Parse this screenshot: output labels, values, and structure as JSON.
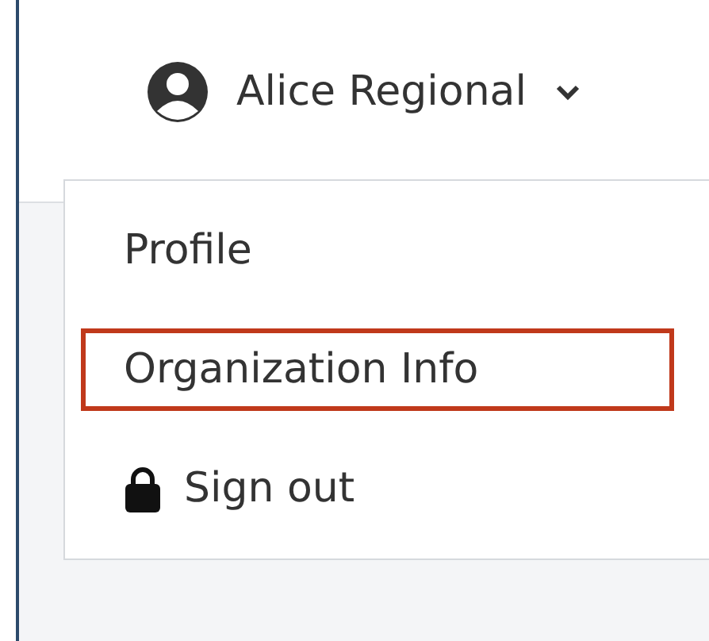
{
  "user_menu": {
    "name": "Alice Regional",
    "expanded": true
  },
  "menu_items": [
    {
      "label": "Profile",
      "kind": "text",
      "selected": false
    },
    {
      "label": "Organization Info",
      "kind": "text",
      "selected": true
    },
    {
      "label": "Sign out",
      "kind": "signout",
      "selected": false
    }
  ]
}
